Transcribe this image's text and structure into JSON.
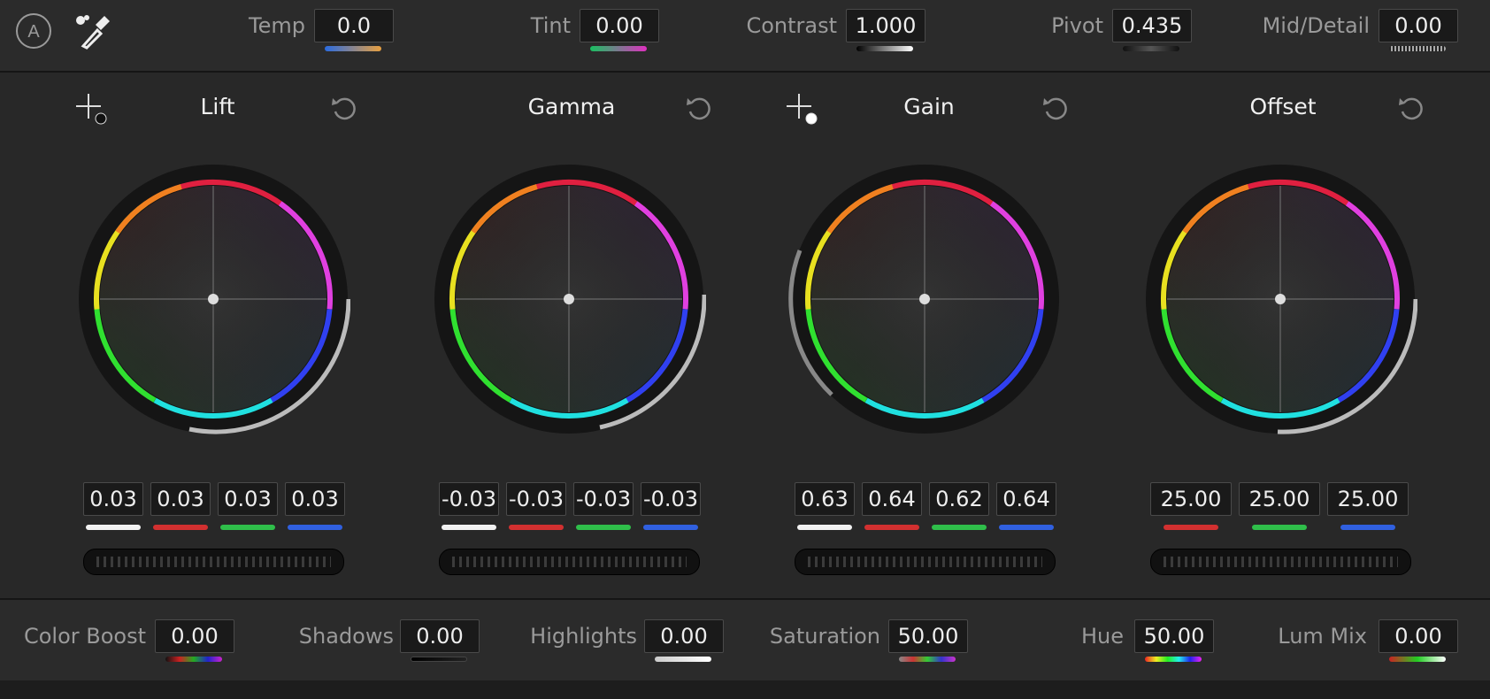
{
  "top": {
    "auto_icon": "A",
    "controls": [
      {
        "label": "Temp",
        "value": "0.0",
        "strip": "linear-gradient(90deg,#2a6be0,#e8a040)"
      },
      {
        "label": "Tint",
        "value": "0.00",
        "strip": "linear-gradient(90deg,#18c060,#e030c0)"
      },
      {
        "label": "Contrast",
        "value": "1.000",
        "strip": "linear-gradient(90deg,#000,#fff)"
      },
      {
        "label": "Pivot",
        "value": "0.435",
        "strip": "linear-gradient(90deg,#111,#444,#111)"
      },
      {
        "label": "Mid/Detail",
        "value": "0.00",
        "strip": "repeating-linear-gradient(90deg,#222 0 2px,#999 2px 4px)"
      }
    ]
  },
  "wheels": [
    {
      "title": "Lift",
      "has_picker": true,
      "picker_dot": "#111",
      "channels": [
        "0.03",
        "0.03",
        "0.03",
        "0.03"
      ]
    },
    {
      "title": "Gamma",
      "has_picker": false,
      "channels": [
        "-0.03",
        "-0.03",
        "-0.03",
        "-0.03"
      ]
    },
    {
      "title": "Gain",
      "has_picker": true,
      "picker_dot": "#fff",
      "channels": [
        "0.63",
        "0.64",
        "0.62",
        "0.64"
      ]
    },
    {
      "title": "Offset",
      "has_picker": false,
      "channels": [
        "25.00",
        "25.00",
        "25.00"
      ]
    }
  ],
  "channel_colors": {
    "y": "#f2f2f2",
    "r": "#d23030",
    "g": "#2fbf4a",
    "b": "#3060e0"
  },
  "bottom": {
    "controls": [
      {
        "label": "Color Boost",
        "value": "0.00",
        "strip": "linear-gradient(90deg,#111,#c22,#2a2,#22c,#c2c)"
      },
      {
        "label": "Shadows",
        "value": "0.00",
        "strip": "linear-gradient(90deg,#000,#222)"
      },
      {
        "label": "Highlights",
        "value": "0.00",
        "strip": "linear-gradient(90deg,#ccc,#fff)"
      },
      {
        "label": "Saturation",
        "value": "50.00",
        "strip": "linear-gradient(90deg,#888,#c33,#3c3,#33c,#c3c)"
      },
      {
        "label": "Hue",
        "value": "50.00",
        "strip": "linear-gradient(90deg,#e22,#ee2,#2e2,#2ee,#22e,#e2e)"
      },
      {
        "label": "Lum Mix",
        "value": "0.00",
        "strip": "linear-gradient(90deg,#c22,#2c2,#fff)"
      }
    ]
  }
}
